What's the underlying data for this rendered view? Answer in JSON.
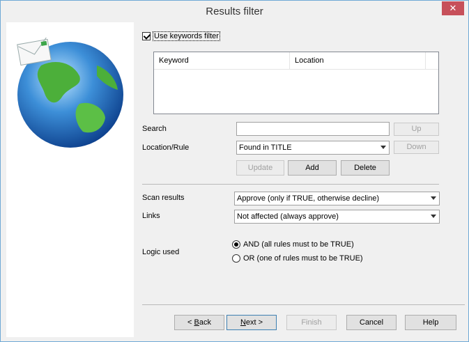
{
  "window": {
    "title": "Results filter",
    "close_symbol": "✕"
  },
  "filter": {
    "checkbox_label": "Use keywords filter",
    "checked": true
  },
  "list": {
    "columns": [
      "Keyword",
      "Location"
    ],
    "rows": []
  },
  "form": {
    "search_label": "Search",
    "search_value": "",
    "location_label": "Location/Rule",
    "location_value": "Found in TITLE",
    "up_label": "Up",
    "down_label": "Down",
    "update_label": "Update",
    "add_label": "Add",
    "delete_label": "Delete",
    "scan_label": "Scan results",
    "scan_value": "Approve (only if TRUE, otherwise decline)",
    "links_label": "Links",
    "links_value": "Not affected (always approve)",
    "logic_label": "Logic used",
    "logic_and": "AND (all rules must to be TRUE)",
    "logic_or": "OR (one of rules must to be TRUE)",
    "logic_selected": "AND"
  },
  "buttons": {
    "back_prefix": "< ",
    "back_accel": "B",
    "back_rest": "ack",
    "next_accel": "N",
    "next_rest": "ext >",
    "finish": "Finish",
    "cancel": "Cancel",
    "help": "Help"
  },
  "icons": {
    "logo": "globe-mail-icon",
    "close": "close-icon",
    "dropdown": "chevron-down-icon"
  }
}
